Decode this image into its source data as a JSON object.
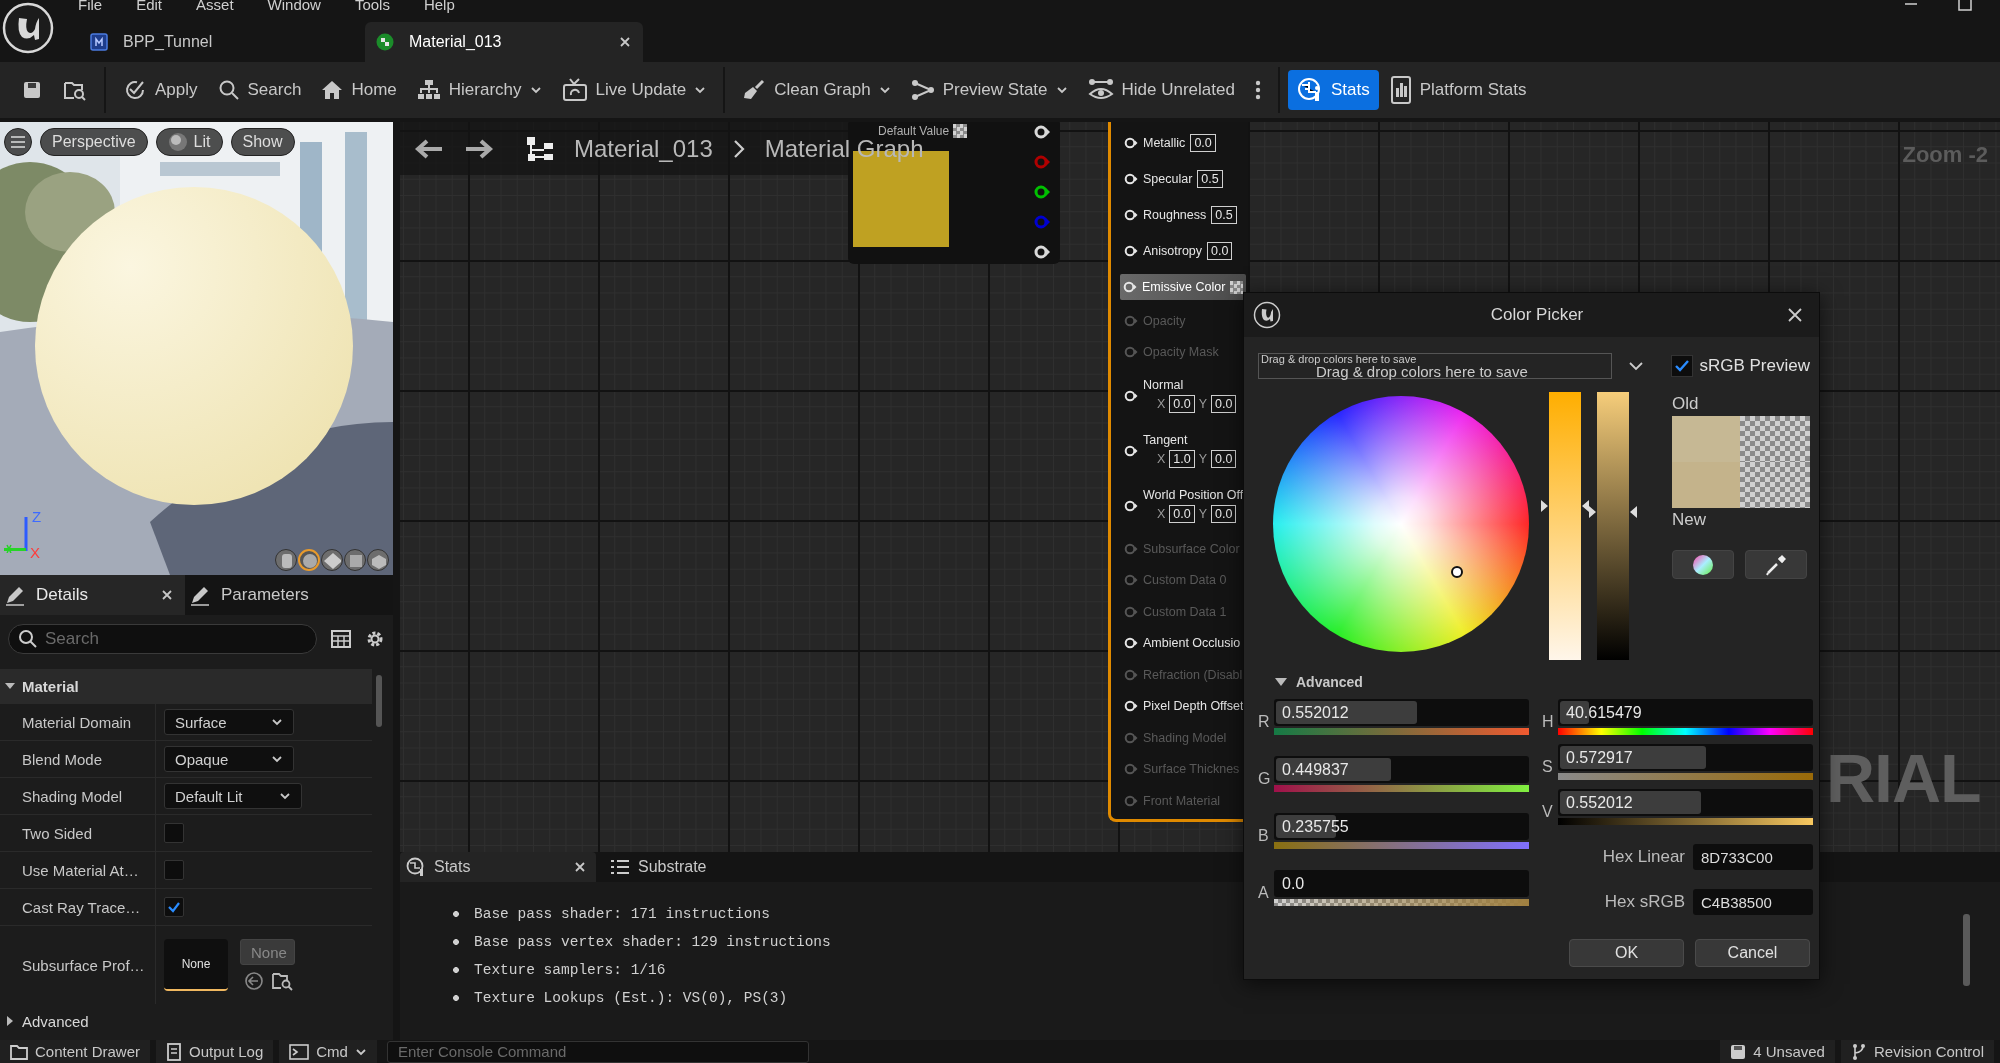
{
  "menu": [
    "File",
    "Edit",
    "Asset",
    "Window",
    "Tools",
    "Help"
  ],
  "document_tabs": [
    {
      "label": "BPP_Tunnel",
      "kind": "blueprint",
      "selected": false,
      "closable": false
    },
    {
      "label": "Material_013",
      "kind": "material",
      "selected": true,
      "closable": true
    }
  ],
  "toolbar": [
    [
      {
        "kind": "save",
        "selected": false
      },
      {
        "kind": "browse",
        "selected": false
      }
    ],
    [
      {
        "kind": "apply",
        "label": "Apply",
        "dropdown": false,
        "selected": false
      },
      {
        "kind": "search",
        "label": "Search",
        "dropdown": false,
        "selected": false
      },
      {
        "kind": "home",
        "label": "Home",
        "dropdown": false,
        "selected": false
      },
      {
        "kind": "hierarchy",
        "label": "Hierarchy",
        "dropdown": true,
        "selected": false
      },
      {
        "kind": "live-update",
        "label": "Live Update",
        "dropdown": true,
        "selected": false
      }
    ],
    [
      {
        "kind": "clean-graph",
        "label": "Clean Graph",
        "dropdown": true,
        "selected": false
      },
      {
        "kind": "preview-state",
        "label": "Preview State",
        "dropdown": true,
        "selected": false
      },
      {
        "kind": "hide-unrelated",
        "label": "Hide Unrelated",
        "dropdown": false,
        "selected": false
      },
      {
        "kind": "more",
        "selected": false
      }
    ],
    [
      {
        "kind": "stats",
        "label": "Stats",
        "dropdown": false,
        "selected": true
      },
      {
        "kind": "platform-stats",
        "label": "Platform Stats",
        "dropdown": false,
        "selected": false
      }
    ]
  ],
  "viewport": {
    "kind": "picture",
    "buttons": [
      {
        "kind": "menu"
      },
      {
        "kind": "text",
        "label": "Perspective"
      },
      {
        "kind": "lit",
        "label": "Lit"
      },
      {
        "kind": "text",
        "label": "Show"
      }
    ],
    "axes": {
      "up": "Z",
      "right": "X"
    },
    "preview_shapes": [
      {
        "kind": "cylinder",
        "selected": false
      },
      {
        "kind": "sphere",
        "selected": true
      },
      {
        "kind": "plane",
        "selected": false
      },
      {
        "kind": "cube",
        "selected": false
      },
      {
        "kind": "mesh",
        "selected": false
      }
    ]
  },
  "details": {
    "tabs": [
      {
        "label": "Details",
        "selected": true,
        "closable": true
      },
      {
        "label": "Parameters",
        "selected": false,
        "closable": false
      }
    ],
    "search": {
      "placeholder": "Search"
    },
    "sections": [
      {
        "title": "Material",
        "expanded": true,
        "rows": [
          {
            "kind": "dropdown",
            "label": "Material Domain",
            "value": "Surface"
          },
          {
            "kind": "dropdown",
            "label": "Blend Mode",
            "value": "Opaque"
          },
          {
            "kind": "dropdown",
            "label": "Shading Model",
            "value": "Default Lit"
          },
          {
            "kind": "checkbox",
            "label": "Two Sided",
            "checked": false
          },
          {
            "kind": "checkbox",
            "label": "Use Material At…",
            "checked": false
          },
          {
            "kind": "checkbox",
            "label": "Cast Ray Trace…",
            "checked": true
          },
          {
            "kind": "asset",
            "label": "Subsurface Prof…",
            "thumbnail": "None",
            "value": "None"
          }
        ]
      },
      {
        "title": "Advanced",
        "expanded": false
      }
    ]
  },
  "graph": {
    "breadcrumb": [
      "Material_013",
      "Material Graph"
    ],
    "zoom": "Zoom -2",
    "node_title": "RIAL",
    "constant_node": {
      "header": "Default Value",
      "color": "#bfa122",
      "outputs": [
        {
          "color": "#d9d9d9"
        },
        {
          "color": "#b00000"
        },
        {
          "color": "#00c000"
        },
        {
          "color": "#0000d0"
        },
        {
          "color": "#d9d9d9"
        }
      ]
    },
    "material_node": {
      "pins": [
        {
          "kind": "scalar",
          "label": "Metallic",
          "value": "0.0",
          "enabled": true,
          "selected": false
        },
        {
          "kind": "scalar",
          "label": "Specular",
          "value": "0.5",
          "enabled": true,
          "selected": false
        },
        {
          "kind": "scalar",
          "label": "Roughness",
          "value": "0.5",
          "enabled": true,
          "selected": false
        },
        {
          "kind": "scalar",
          "label": "Anisotropy",
          "value": "0.0",
          "enabled": true,
          "selected": false
        },
        {
          "kind": "color",
          "label": "Emissive Color",
          "enabled": true,
          "selected": true
        },
        {
          "kind": "plain",
          "label": "Opacity",
          "enabled": false,
          "selected": false
        },
        {
          "kind": "plain",
          "label": "Opacity Mask",
          "enabled": false,
          "selected": false
        },
        {
          "kind": "vector",
          "label": "Normal",
          "components": [
            {
              "axis": "X",
              "value": "0.0"
            },
            {
              "axis": "Y",
              "value": "0.0"
            }
          ],
          "enabled": true,
          "selected": false
        },
        {
          "kind": "vector",
          "label": "Tangent",
          "components": [
            {
              "axis": "X",
              "value": "1.0"
            },
            {
              "axis": "Y",
              "value": "0.0"
            }
          ],
          "enabled": true,
          "selected": false
        },
        {
          "kind": "vector",
          "label": "World Position Off",
          "components": [
            {
              "axis": "X",
              "value": "0.0"
            },
            {
              "axis": "Y",
              "value": "0.0"
            }
          ],
          "enabled": true,
          "selected": false
        },
        {
          "kind": "plain",
          "label": "Subsurface Color",
          "enabled": false,
          "selected": false
        },
        {
          "kind": "plain",
          "label": "Custom Data 0",
          "enabled": false,
          "selected": false
        },
        {
          "kind": "plain",
          "label": "Custom Data 1",
          "enabled": false,
          "selected": false
        },
        {
          "kind": "plain",
          "label": "Ambient Occlusio",
          "enabled": true,
          "selected": false
        },
        {
          "kind": "plain",
          "label": "Refraction (Disabl",
          "enabled": false,
          "selected": false
        },
        {
          "kind": "plain",
          "label": "Pixel Depth Offset",
          "enabled": true,
          "selected": false
        },
        {
          "kind": "plain",
          "label": "Shading Model",
          "enabled": false,
          "selected": false
        },
        {
          "kind": "plain",
          "label": "Surface Thicknes",
          "enabled": false,
          "selected": false
        },
        {
          "kind": "plain",
          "label": "Front Material",
          "enabled": false,
          "selected": false
        }
      ]
    }
  },
  "stats": {
    "tabs": [
      {
        "label": "Stats",
        "selected": true,
        "closable": true
      },
      {
        "label": "Substrate",
        "selected": false,
        "closable": false
      }
    ],
    "lines": [
      "Base pass shader: 171 instructions",
      "Base pass vertex shader: 129 instructions",
      "Texture samplers: 1/16",
      "Texture Lookups (Est.): VS(0), PS(3)"
    ]
  },
  "color_picker": {
    "title": "Color Picker",
    "saved_colors": {
      "hint": "Drag & drop colors here to save",
      "placeholder": "Drag & drop colors here to save"
    },
    "srgb_preview": {
      "label": "sRGB Preview",
      "checked": true
    },
    "old": {
      "label": "Old",
      "color": "#c6b894"
    },
    "new": {
      "label": "New",
      "color": "#c4b38b"
    },
    "advanced": {
      "label": "Advanced",
      "expanded": true
    },
    "rgba_channels": [
      {
        "kind": "red",
        "label": "R",
        "value": "0.552012",
        "level": 0.552
      },
      {
        "kind": "green",
        "label": "G",
        "value": "0.449837",
        "level": 0.45
      },
      {
        "kind": "blue",
        "label": "B",
        "value": "0.235755",
        "level": 0.236
      },
      {
        "kind": "alpha",
        "label": "A",
        "value": "0.0"
      }
    ],
    "hsv_channels": [
      {
        "kind": "hue",
        "label": "H",
        "value": "40.615479",
        "level": 0.113
      },
      {
        "kind": "saturation",
        "label": "S",
        "value": "0.572917",
        "level": 0.573
      },
      {
        "kind": "value",
        "label": "V",
        "value": "0.552012",
        "level": 0.552
      }
    ],
    "hex": [
      {
        "label": "Hex Linear",
        "value": "8D733C00"
      },
      {
        "label": "Hex sRGB",
        "value": "C4B38500"
      }
    ],
    "buttons": [
      "OK",
      "Cancel"
    ]
  },
  "status_bar": {
    "buttons": [
      {
        "kind": "content-drawer",
        "label": "Content Drawer",
        "dropdown": false
      },
      {
        "kind": "output-log",
        "label": "Output Log",
        "dropdown": false
      },
      {
        "kind": "cmd",
        "label": "Cmd",
        "dropdown": true
      }
    ],
    "console": {
      "placeholder": "Enter Console Command"
    },
    "right": [
      {
        "kind": "unsaved",
        "label": "4 Unsaved"
      },
      {
        "kind": "revision",
        "label": "Revision Control"
      }
    ]
  }
}
